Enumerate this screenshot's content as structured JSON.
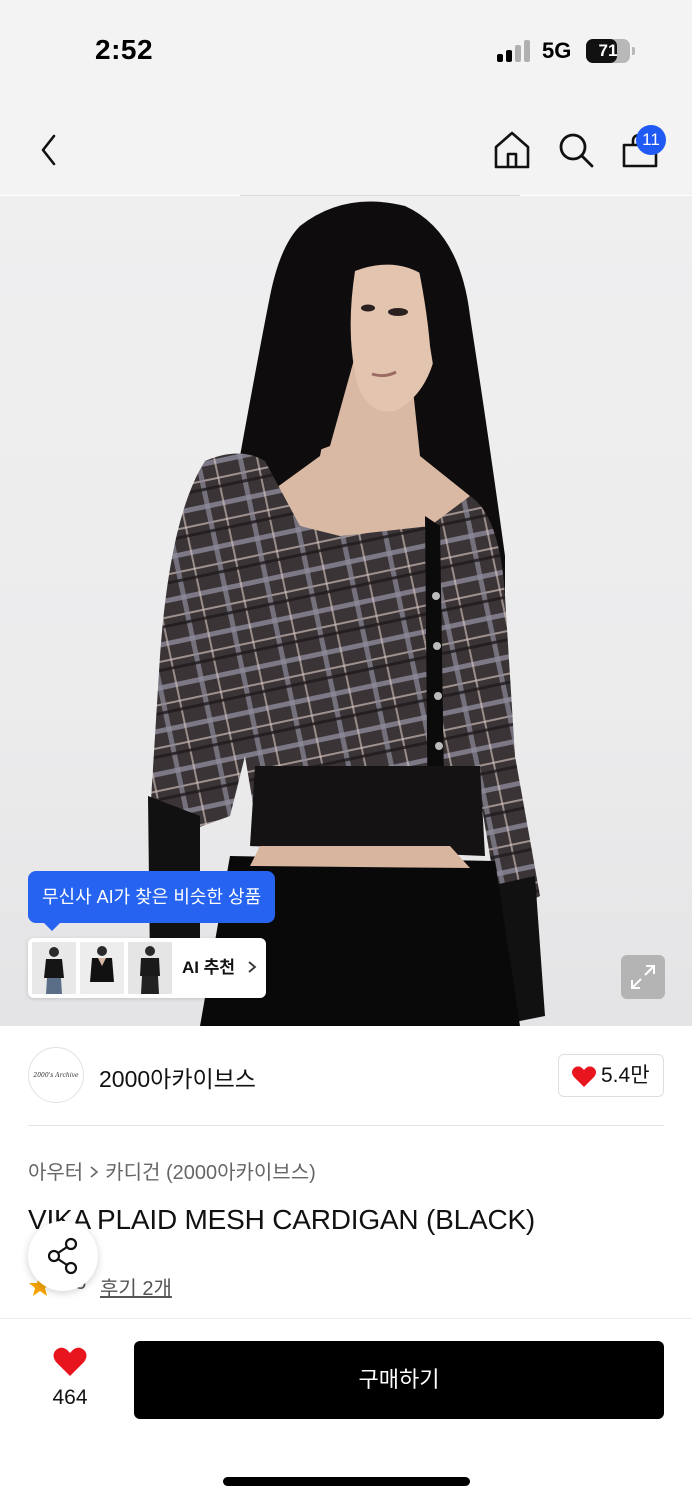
{
  "status_bar": {
    "time": "2:52",
    "network": "5G",
    "battery": "71",
    "battery_level": 0.71
  },
  "nav": {
    "back_icon": "chevron-left-icon",
    "home_icon": "home-icon",
    "search_icon": "search-icon",
    "cart_icon": "shopping-bag-icon",
    "cart_badge": "11",
    "badge_color": "#1f5af5"
  },
  "hero": {
    "ai_tooltip": "무신사 AI가 찾은 비슷한 상품",
    "ai_recommend_label": "AI 추천",
    "expand_icon": "expand-icon"
  },
  "brand": {
    "logo_text": "2000's Archive",
    "name": "2000아카이브스",
    "likes": "5.4만",
    "heart_color": "#e8141e"
  },
  "product": {
    "breadcrumb": [
      "아우터",
      "카디건 (2000아카이브스)"
    ],
    "title": "VIKA PLAID MESH CARDIGAN (BLACK)",
    "rating": "..5",
    "reviews": "후기 2개"
  },
  "bottom": {
    "wish_count": "464",
    "buy_label": "구매하기"
  },
  "colors": {
    "accent": "#2563f0",
    "buy_button": "#000000"
  }
}
